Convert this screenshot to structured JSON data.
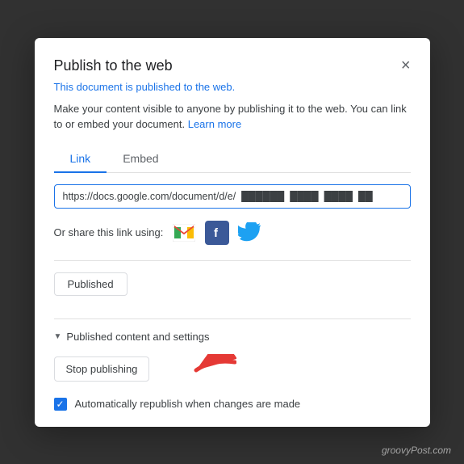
{
  "modal": {
    "title": "Publish to the web",
    "close_label": "×",
    "published_notice": "This document is published to the web.",
    "description": "Make your content visible to anyone by publishing it to the web. You can link to or embed your document.",
    "learn_more_label": "Learn more"
  },
  "tabs": {
    "link_label": "Link",
    "embed_label": "Embed"
  },
  "url": {
    "value": "https://docs.google.com/document/d/e/",
    "placeholder": ""
  },
  "share": {
    "prefix_label": "Or share this link using:"
  },
  "published_button": {
    "label": "Published"
  },
  "settings_section": {
    "label": "Published content and settings"
  },
  "stop_publishing": {
    "label": "Stop publishing"
  },
  "checkbox": {
    "label": "Automatically republish when changes are made"
  },
  "watermark": {
    "text": "groovyPost.com"
  }
}
